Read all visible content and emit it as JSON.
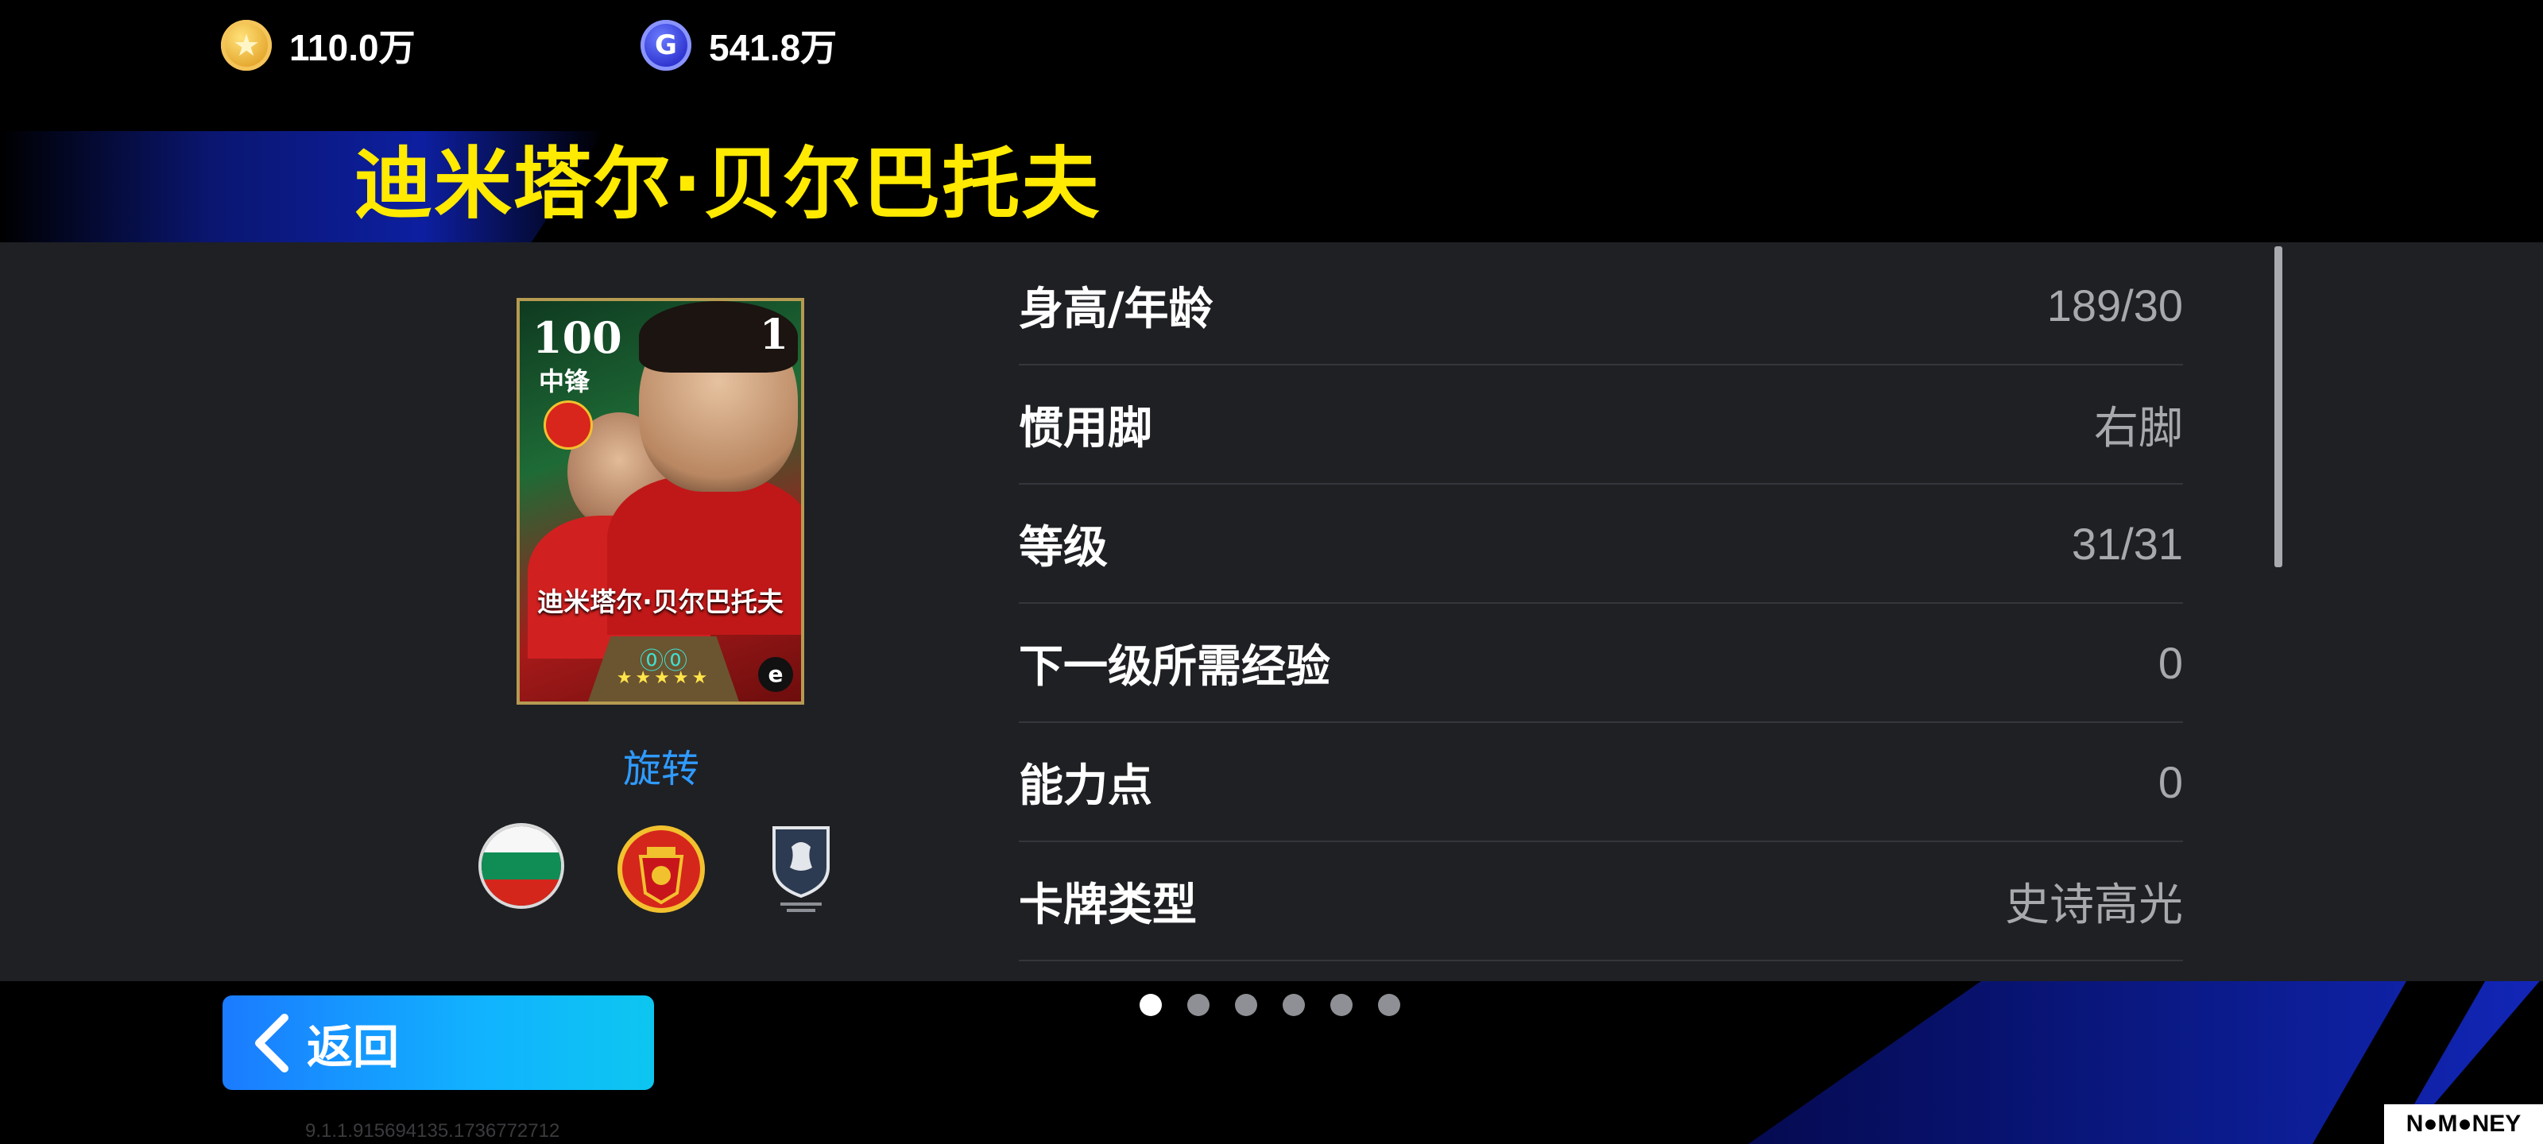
{
  "currency": {
    "coins": {
      "icon": "star-coin-icon",
      "value": "110.0万"
    },
    "gp": {
      "icon": "g-coin-icon",
      "glyph": "G",
      "value": "541.8万"
    }
  },
  "player": {
    "name": "迪米塔尔·贝尔巴托夫",
    "card": {
      "rating": "100",
      "position": "中锋",
      "level_badge": "1",
      "name": "迪米塔尔·贝尔巴托夫",
      "skill_glyphs": "⓪⓪",
      "stars": "★★★★★",
      "brand_glyph": "e"
    },
    "rotate_label": "旋转",
    "badges": [
      "bulgaria-flag",
      "manchester-united-crest",
      "english-league-logo"
    ]
  },
  "stats": [
    {
      "key": "身高/年龄",
      "value": "189/30"
    },
    {
      "key": "惯用脚",
      "value": "右脚"
    },
    {
      "key": "等级",
      "value": "31/31"
    },
    {
      "key": "下一级所需经验",
      "value": "0"
    },
    {
      "key": "能力点",
      "value": "0"
    },
    {
      "key": "卡牌类型",
      "value": "史诗高光"
    }
  ],
  "pager": {
    "pages": 6,
    "active": 1
  },
  "back_button": {
    "label": "返回"
  },
  "version": "9.1.1.915694135.1736772712",
  "watermark": "N●M●NEY",
  "colors": {
    "accent": "#ffea00",
    "link": "#2f9bff",
    "button": "#1b7bff"
  }
}
